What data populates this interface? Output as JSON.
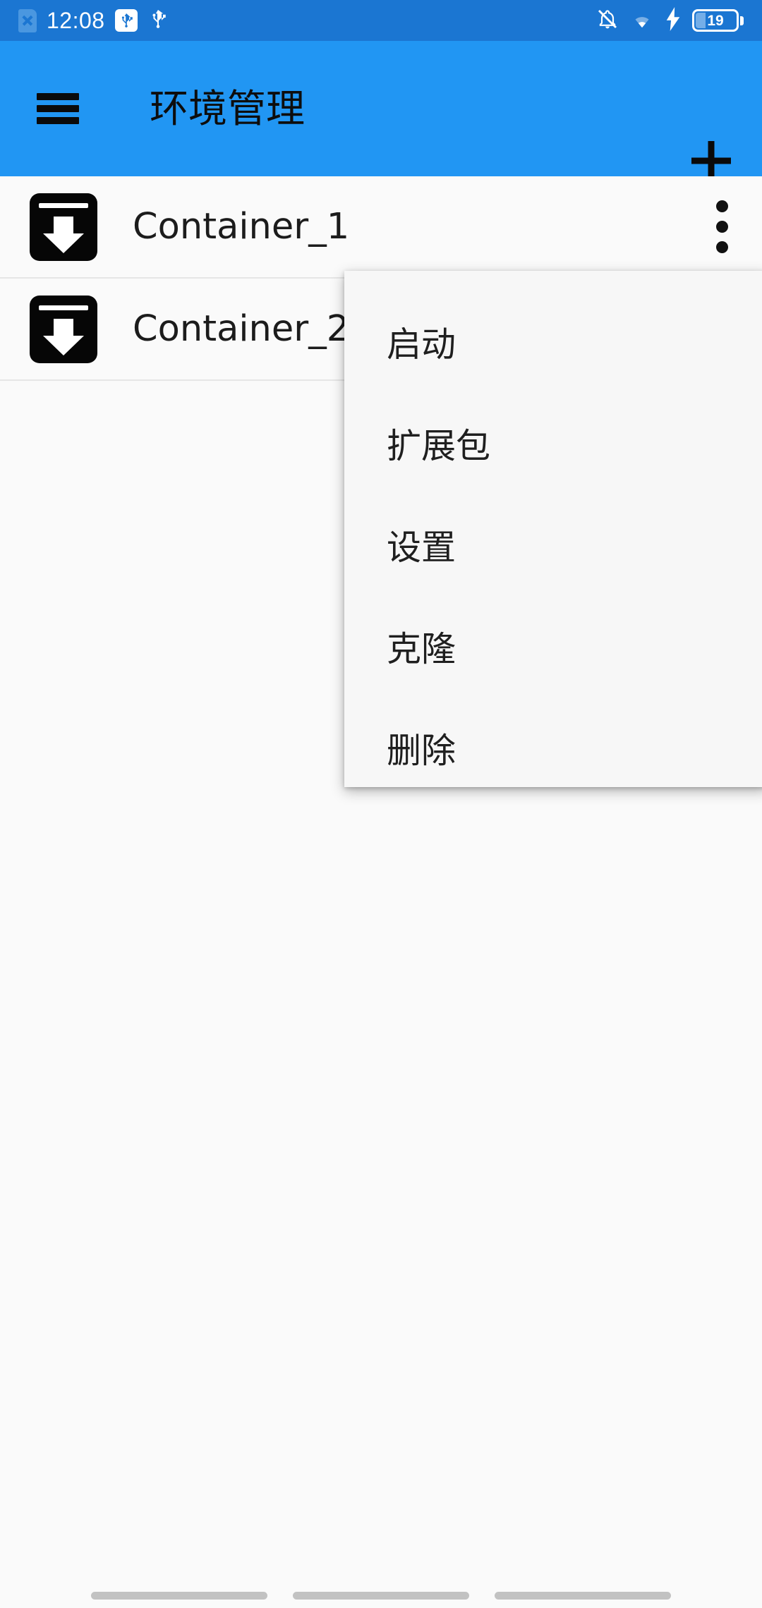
{
  "status_bar": {
    "time": "12:08",
    "background_color": "#1b76d2",
    "icons": {
      "sim": "sim-card-x-icon",
      "usb_debug": "usb-debug-icon",
      "usb": "usb-icon",
      "notifications_silenced": "bell-off-icon",
      "wifi": "wifi-icon",
      "charging": "charging-bolt-icon"
    },
    "battery": {
      "level": "19",
      "charging": true
    }
  },
  "app_bar": {
    "title": "环境管理",
    "background_color": "#2196f3",
    "menu_icon": "hamburger-menu-icon",
    "add_icon": "plus-icon"
  },
  "list": {
    "items": [
      {
        "label": "Container_1",
        "icon": "container-download-icon",
        "overflow_icon": "more-vertical-icon"
      },
      {
        "label": "Container_2",
        "icon": "container-download-icon",
        "overflow_icon": "more-vertical-icon"
      }
    ]
  },
  "popup_menu": {
    "items": [
      {
        "label": "启动"
      },
      {
        "label": "扩展包"
      },
      {
        "label": "设置"
      },
      {
        "label": "克隆"
      },
      {
        "label": "删除"
      }
    ]
  },
  "nav_bar": {
    "pills": [
      "back-pill",
      "home-pill",
      "recents-pill"
    ]
  }
}
